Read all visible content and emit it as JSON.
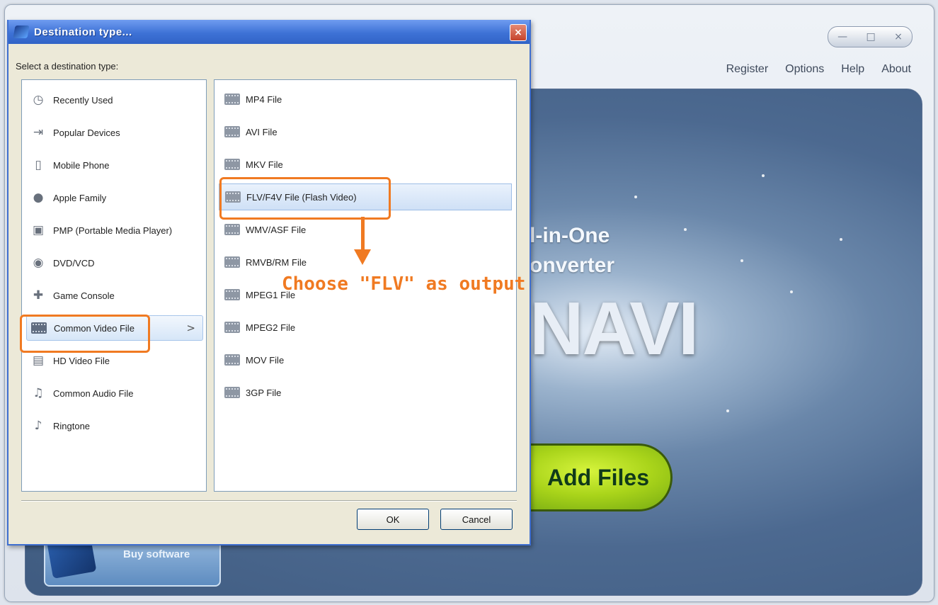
{
  "window": {
    "controls": [
      "—",
      "□",
      "×"
    ],
    "menu": [
      "Register",
      "Options",
      "Help",
      "About"
    ]
  },
  "background": {
    "brand_line1": "l-in-One",
    "brand_line2": "onverter",
    "brand_logo": "NAVI",
    "add_files_label": "Add Files",
    "buy_label": "Buy software"
  },
  "dialog": {
    "title": "Destination type...",
    "close_glyph": "×",
    "prompt": "Select a destination type:",
    "categories": [
      {
        "label": "Recently Used",
        "icon": "clock-icon"
      },
      {
        "label": "Popular Devices",
        "icon": "arrow-box-icon"
      },
      {
        "label": "Mobile Phone",
        "icon": "phone-icon"
      },
      {
        "label": "Apple Family",
        "icon": "apple-icon"
      },
      {
        "label": "PMP (Portable Media Player)",
        "icon": "media-player-icon"
      },
      {
        "label": "DVD/VCD",
        "icon": "disc-icon"
      },
      {
        "label": "Game Console",
        "icon": "gamepad-icon"
      },
      {
        "label": "Common Video File",
        "icon": "film-icon",
        "selected": true
      },
      {
        "label": "HD Video File",
        "icon": "hd-icon"
      },
      {
        "label": "Common Audio File",
        "icon": "music-note-icon"
      },
      {
        "label": "Ringtone",
        "icon": "ringtone-icon"
      }
    ],
    "selected_arrow": ">",
    "formats": [
      {
        "label": "MP4 File"
      },
      {
        "label": "AVI File"
      },
      {
        "label": "MKV File"
      },
      {
        "label": "FLV/F4V File (Flash Video)",
        "selected": true
      },
      {
        "label": "WMV/ASF File"
      },
      {
        "label": "RMVB/RM File"
      },
      {
        "label": "MPEG1 File"
      },
      {
        "label": "MPEG2 File"
      },
      {
        "label": "MOV File"
      },
      {
        "label": "3GP File"
      }
    ],
    "ok_label": "OK",
    "cancel_label": "Cancel"
  },
  "annotation": {
    "text": "Choose \"FLV\" as output",
    "color": "#f07a22"
  }
}
